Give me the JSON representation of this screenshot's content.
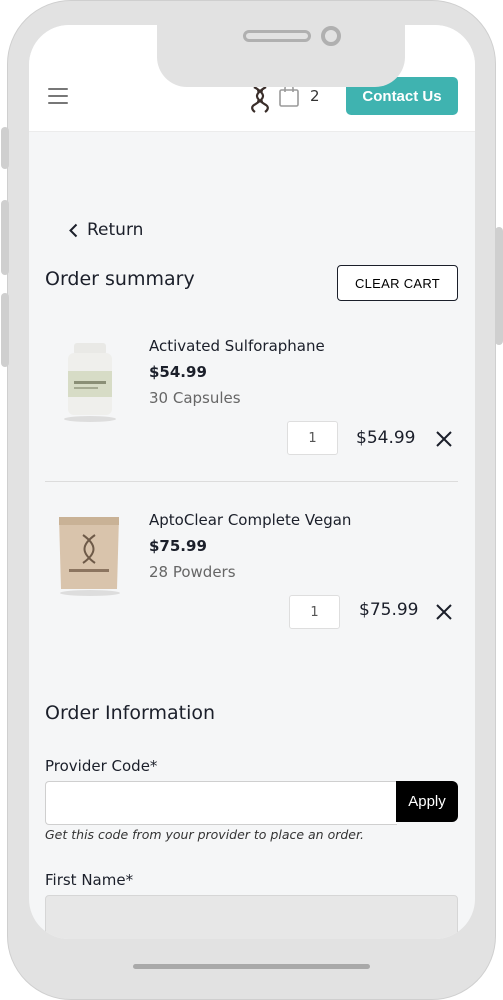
{
  "header": {
    "cart_count": "2",
    "contact_label": "Contact Us",
    "accent_color": "#3fb3b0"
  },
  "nav": {
    "return_label": "Return"
  },
  "summary": {
    "title": "Order summary",
    "clear_label": "CLEAR CART",
    "items": [
      {
        "name": "Activated Sulforaphane",
        "price": "$54.99",
        "size": "30 Capsules",
        "quantity": "1",
        "total": "$54.99",
        "image_icon": "supplement-bottle"
      },
      {
        "name": "AptoClear Complete Vegan",
        "price": "$75.99",
        "size": "28 Powders",
        "quantity": "1",
        "total": "$75.99",
        "image_icon": "powder-pouch"
      }
    ]
  },
  "order_info": {
    "title": "Order Information",
    "provider_label": "Provider Code*",
    "provider_value": "",
    "apply_label": "Apply",
    "hint": "Get this code from your provider to place an order.",
    "first_name_label": "First Name*",
    "first_name_value": ""
  }
}
